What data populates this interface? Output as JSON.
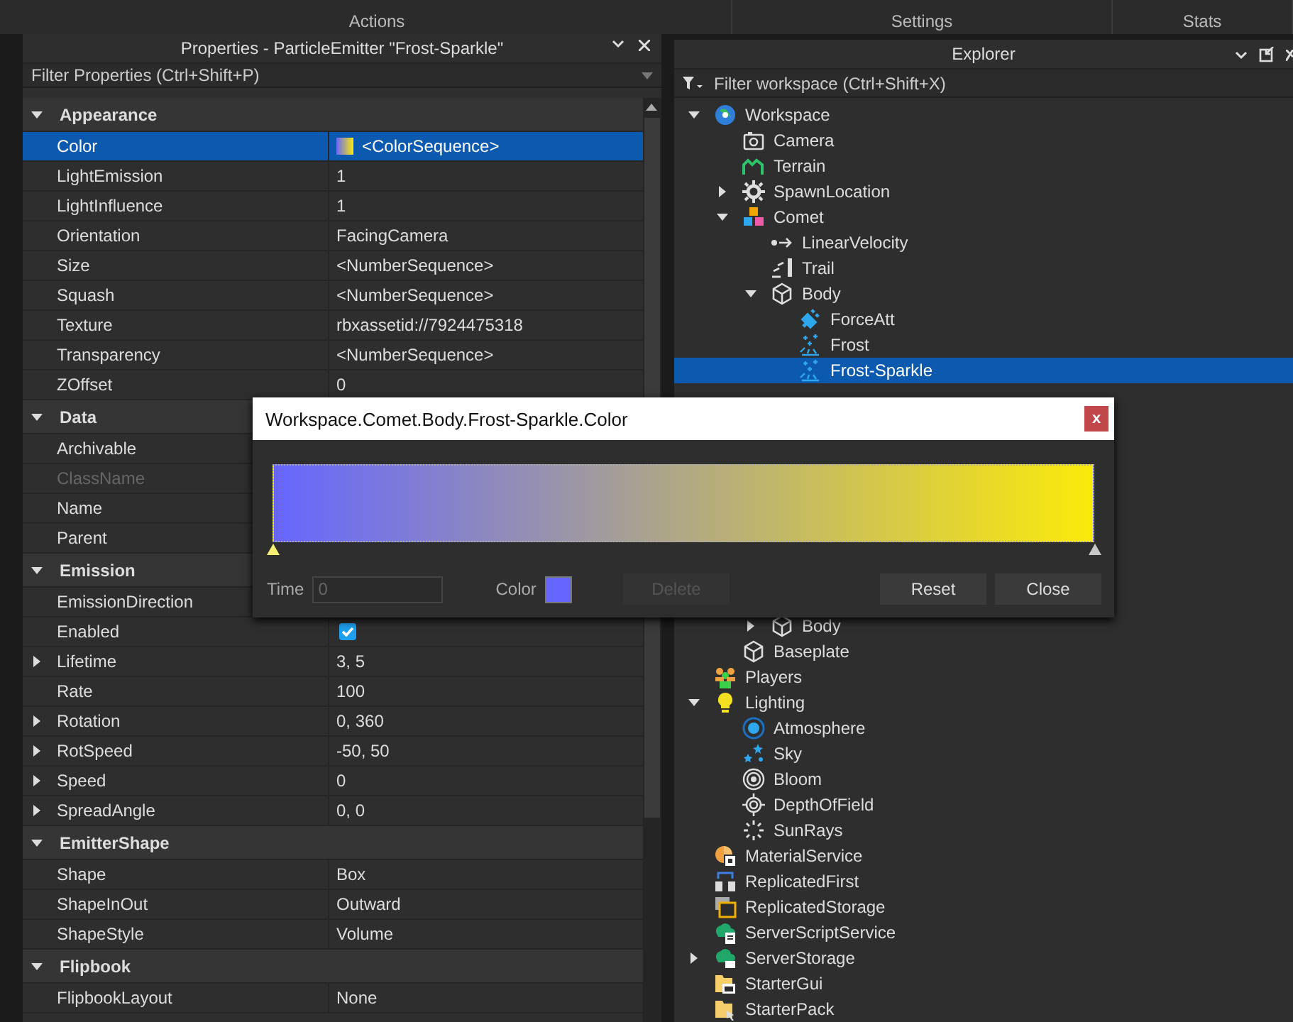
{
  "ribbon": {
    "tabs": [
      "Actions",
      "Settings",
      "Stats"
    ]
  },
  "properties": {
    "title": "Properties - ParticleEmitter \"Frost-Sparkle\"",
    "filter_placeholder": "Filter Properties (Ctrl+Shift+P)",
    "groups": [
      {
        "name": "Appearance",
        "expanded": true,
        "rows": [
          {
            "name": "Color",
            "value": "<ColorSequence>",
            "kind": "sequence",
            "selected": true,
            "disabled": false
          },
          {
            "name": "LightEmission",
            "value": "1",
            "kind": "text",
            "selected": false,
            "disabled": false
          },
          {
            "name": "LightInfluence",
            "value": "1",
            "kind": "text",
            "selected": false,
            "disabled": false
          },
          {
            "name": "Orientation",
            "value": "FacingCamera",
            "kind": "text",
            "selected": false,
            "disabled": false
          },
          {
            "name": "Size",
            "value": "<NumberSequence>",
            "kind": "text",
            "selected": false,
            "disabled": false
          },
          {
            "name": "Squash",
            "value": "<NumberSequence>",
            "kind": "text",
            "selected": false,
            "disabled": false
          },
          {
            "name": "Texture",
            "value": "rbxassetid://7924475318",
            "kind": "text",
            "selected": false,
            "disabled": false
          },
          {
            "name": "Transparency",
            "value": "<NumberSequence>",
            "kind": "text",
            "selected": false,
            "disabled": false
          },
          {
            "name": "ZOffset",
            "value": "0",
            "kind": "text",
            "selected": false,
            "disabled": false
          }
        ]
      },
      {
        "name": "Data",
        "expanded": true,
        "rows": [
          {
            "name": "Archivable",
            "kind": "text",
            "selected": false,
            "disabled": false
          },
          {
            "name": "ClassName",
            "kind": "text",
            "selected": false,
            "disabled": true
          },
          {
            "name": "Name",
            "kind": "text",
            "selected": false,
            "disabled": false
          },
          {
            "name": "Parent",
            "kind": "text",
            "selected": false,
            "disabled": false
          }
        ]
      },
      {
        "name": "Emission",
        "expanded": true,
        "rows": [
          {
            "name": "EmissionDirection",
            "kind": "text",
            "selected": false,
            "disabled": false
          },
          {
            "name": "Enabled",
            "kind": "checkbox",
            "checked": true,
            "selected": false,
            "disabled": false
          },
          {
            "name": "Lifetime",
            "value": "3, 5",
            "kind": "text",
            "expanded": false,
            "selected": false,
            "disabled": false
          },
          {
            "name": "Rate",
            "value": "100",
            "kind": "text",
            "selected": false,
            "disabled": false
          },
          {
            "name": "Rotation",
            "value": "0, 360",
            "kind": "text",
            "expanded": false,
            "selected": false,
            "disabled": false
          },
          {
            "name": "RotSpeed",
            "value": "-50, 50",
            "kind": "text",
            "expanded": false,
            "selected": false,
            "disabled": false
          },
          {
            "name": "Speed",
            "value": "0",
            "kind": "text",
            "expanded": false,
            "selected": false,
            "disabled": false
          },
          {
            "name": "SpreadAngle",
            "value": "0, 0",
            "kind": "text",
            "expanded": false,
            "selected": false,
            "disabled": false
          }
        ]
      },
      {
        "name": "EmitterShape",
        "expanded": true,
        "rows": [
          {
            "name": "Shape",
            "value": "Box",
            "kind": "text",
            "selected": false,
            "disabled": false
          },
          {
            "name": "ShapeInOut",
            "value": "Outward",
            "kind": "text",
            "selected": false,
            "disabled": false
          },
          {
            "name": "ShapeStyle",
            "value": "Volume",
            "kind": "text",
            "selected": false,
            "disabled": false
          }
        ]
      },
      {
        "name": "Flipbook",
        "expanded": true,
        "rows": [
          {
            "name": "FlipbookLayout",
            "value": "None",
            "kind": "text",
            "selected": false,
            "disabled": false
          }
        ]
      }
    ]
  },
  "explorer": {
    "title": "Explorer",
    "filter_placeholder": "Filter workspace (Ctrl+Shift+X)",
    "tree": [
      {
        "name": "Workspace",
        "kind": "workspace",
        "expanded": true,
        "selected": false,
        "children": [
          {
            "name": "Camera",
            "kind": "camera",
            "selected": false
          },
          {
            "name": "Terrain",
            "kind": "terrain",
            "selected": false
          },
          {
            "name": "SpawnLocation",
            "kind": "spawn",
            "expanded": false,
            "selected": false
          },
          {
            "name": "Comet",
            "kind": "model",
            "expanded": true,
            "selected": false,
            "children": [
              {
                "name": "LinearVelocity",
                "kind": "velocity",
                "selected": false
              },
              {
                "name": "Trail",
                "kind": "trail",
                "selected": false
              },
              {
                "name": "Body",
                "kind": "part",
                "expanded": true,
                "selected": false,
                "children": [
                  {
                    "name": "ForceAtt",
                    "kind": "attachment",
                    "selected": false
                  },
                  {
                    "name": "Frost",
                    "kind": "particles",
                    "selected": false
                  },
                  {
                    "name": "Frost-Sparkle",
                    "kind": "particles",
                    "selected": true
                  }
                ]
              },
              {
                "name": "Body",
                "kind": "part",
                "expanded": false,
                "selected": false
              }
            ]
          },
          {
            "name": "Baseplate",
            "kind": "part",
            "selected": false
          }
        ]
      },
      {
        "name": "Players",
        "kind": "players",
        "selected": false
      },
      {
        "name": "Lighting",
        "kind": "lighting",
        "expanded": true,
        "selected": false,
        "children": [
          {
            "name": "Atmosphere",
            "kind": "atmosphere",
            "selected": false
          },
          {
            "name": "Sky",
            "kind": "sky",
            "selected": false
          },
          {
            "name": "Bloom",
            "kind": "bloom",
            "selected": false
          },
          {
            "name": "DepthOfField",
            "kind": "dof",
            "selected": false
          },
          {
            "name": "SunRays",
            "kind": "sunrays",
            "selected": false
          }
        ]
      },
      {
        "name": "MaterialService",
        "kind": "material",
        "selected": false
      },
      {
        "name": "ReplicatedFirst",
        "kind": "repfirst",
        "selected": false
      },
      {
        "name": "ReplicatedStorage",
        "kind": "repstorage",
        "selected": false
      },
      {
        "name": "ServerScriptService",
        "kind": "sss",
        "selected": false
      },
      {
        "name": "ServerStorage",
        "kind": "serverstorage",
        "expanded": false,
        "selected": false
      },
      {
        "name": "StarterGui",
        "kind": "startergui",
        "selected": false
      },
      {
        "name": "StarterPack",
        "kind": "starterpack",
        "selected": false
      }
    ]
  },
  "dialog": {
    "title": "Workspace.Comet.Body.Frost-Sparkle.Color",
    "close": "x",
    "keypoints": [
      {
        "color": "#6666ff",
        "selected": true
      },
      {
        "color": "#fbea0a",
        "selected": false
      }
    ],
    "time_label": "Time",
    "time_value": "0",
    "time_disabled": true,
    "color_label": "Color",
    "color": "#6666ff",
    "buttons": [
      {
        "label": "Delete",
        "disabled": true
      },
      {
        "label": "Reset",
        "disabled": false
      },
      {
        "label": "Close",
        "disabled": false
      }
    ]
  }
}
